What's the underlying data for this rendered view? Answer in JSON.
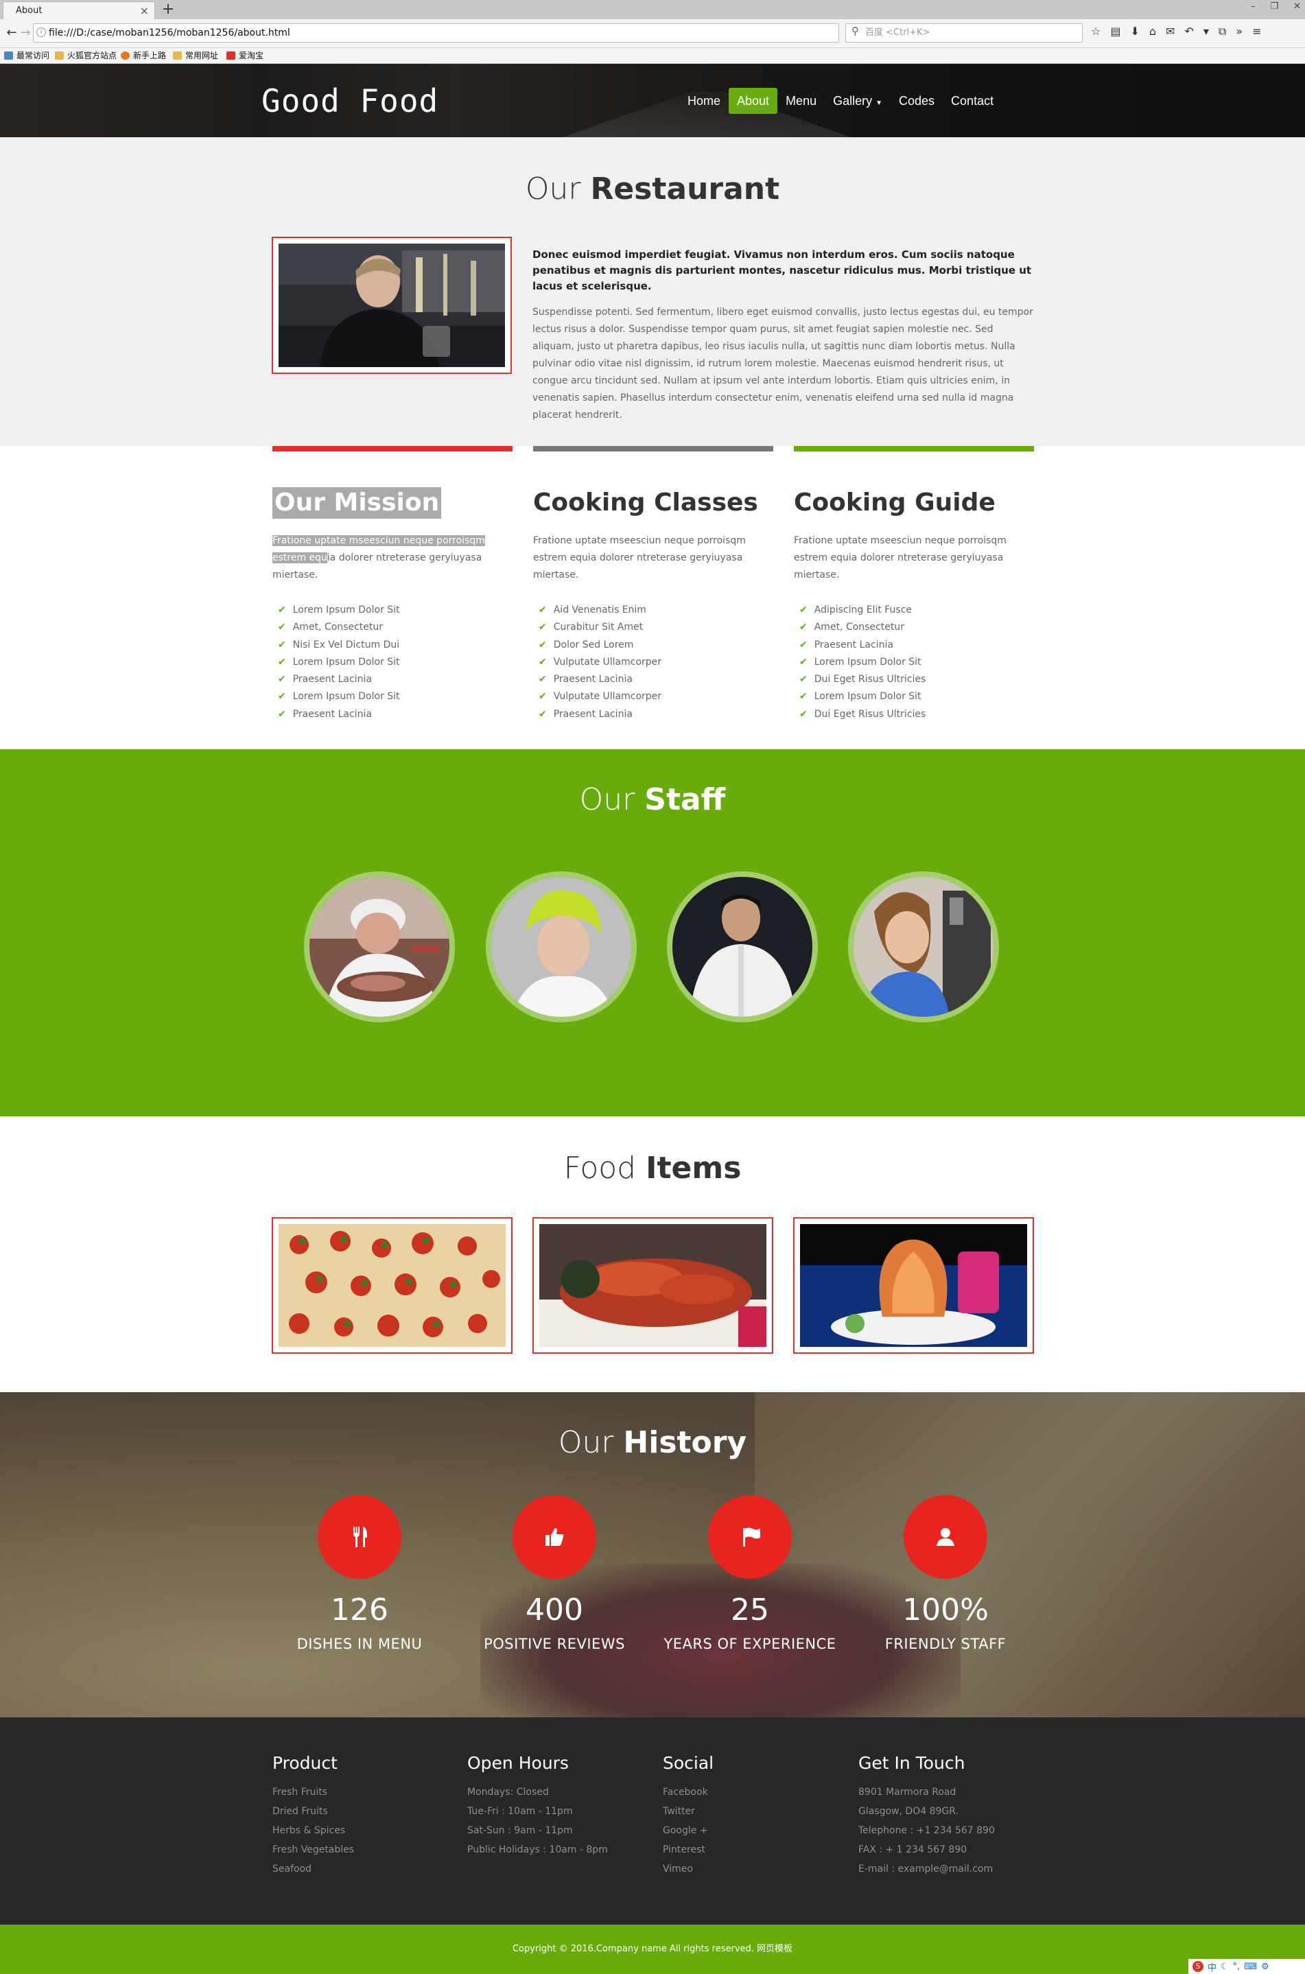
{
  "browser": {
    "tab_title": "About",
    "new_tab_label": "+",
    "url": "file:///D:/case/moban1256/moban1256/about.html",
    "search_placeholder": "百度 <Ctrl+K>",
    "bookmarks": [
      "最常访问",
      "火狐官方站点",
      "新手上路",
      "常用网址",
      "爱淘宝"
    ]
  },
  "site": {
    "logo": "Good Food",
    "nav": [
      {
        "label": "Home",
        "active": false
      },
      {
        "label": "About",
        "active": true
      },
      {
        "label": "Menu",
        "active": false
      },
      {
        "label": "Gallery",
        "active": false,
        "dropdown": true
      },
      {
        "label": "Codes",
        "active": false
      },
      {
        "label": "Contact",
        "active": false
      }
    ],
    "accent_green": "#68ac0b",
    "accent_red": "#e0302a"
  },
  "restaurant": {
    "title_light": "Our",
    "title_bold": "Restaurant",
    "lead": "Donec euismod imperdiet feugiat. Vivamus non interdum eros. Cum sociis natoque penatibus et magnis dis parturient montes, nascetur ridiculus mus. Morbi tristique ut lacus et scelerisque.",
    "body": "Suspendisse potenti. Sed fermentum, libero eget euismod convallis, justo lectus egestas dui, eu tempor lectus risus a dolor. Suspendisse tempor quam purus, sit amet feugiat sapien molestie nec. Sed aliquam, justo ut pharetra dapibus, leo risus iaculis nulla, ut sagittis nunc diam lobortis metus. Nulla pulvinar odio vitae nisl dignissim, id rutrum lorem molestie. Maecenas euismod hendrerit risus, ut congue arcu tincidunt sed. Nullam at ipsum vel ante interdum lobortis. Etiam quis ultricies enim, in venenatis sapien. Phasellus interdum consectetur enim, venenatis eleifend urna sed nulla id magna placerat hendrerit."
  },
  "features": [
    {
      "title": "Our Mission",
      "bar_color": "#e0302a",
      "text_selected": "Fratione uptate mseesciun neque porroisqm estrem equ",
      "text_rest": "ia dolorer ntreterase geryiuyasa miertase.",
      "items": [
        "Lorem Ipsum Dolor Sit",
        "Amet, Consectetur",
        "Nisi Ex Vel Dictum Dui",
        "Lorem Ipsum Dolor Sit",
        "Praesent Lacinia",
        "Lorem Ipsum Dolor Sit",
        "Praesent Lacinia"
      ]
    },
    {
      "title": "Cooking Classes",
      "bar_color": "#777777",
      "text_selected": "",
      "text_rest": "Fratione uptate mseesciun neque porroisqm estrem equia dolorer ntreterase geryiuyasa miertase.",
      "items": [
        "Aid Venenatis Enim",
        "Curabitur Sit Amet",
        "Dolor Sed Lorem",
        "Vulputate Ullamcorper",
        "Praesent Lacinia",
        "Vulputate Ullamcorper",
        "Praesent Lacinia"
      ]
    },
    {
      "title": "Cooking Guide",
      "bar_color": "#68ac0b",
      "text_selected": "",
      "text_rest": "Fratione uptate mseesciun neque porroisqm estrem equia dolorer ntreterase geryiuyasa miertase.",
      "items": [
        "Adipiscing Elit Fusce",
        "Amet, Consectetur",
        "Praesent Lacinia",
        "Lorem Ipsum Dolor Sit",
        "Dui Eget Risus Ultricies",
        "Lorem Ipsum Dolor Sit",
        "Dui Eget Risus Ultricies"
      ]
    }
  ],
  "staff": {
    "title_light": "Our",
    "title_bold": "Staff"
  },
  "food": {
    "title_light": "Food",
    "title_bold": "Items"
  },
  "history": {
    "title_light": "Our",
    "title_bold": "History",
    "stats": [
      {
        "icon": "cutlery-icon",
        "number": "126",
        "label": "DISHES IN MENU"
      },
      {
        "icon": "thumbs-up-icon",
        "number": "400",
        "label": "POSITIVE REVIEWS"
      },
      {
        "icon": "flag-icon",
        "number": "25",
        "label": "YEARS OF EXPERIENCE"
      },
      {
        "icon": "user-icon",
        "number": "100%",
        "label": "FRIENDLY STAFF"
      }
    ]
  },
  "footer": {
    "product": {
      "title": "Product",
      "items": [
        "Fresh Fruits",
        "Dried Fruits",
        "Herbs & Spices",
        "Fresh Vegetables",
        "Seafood"
      ]
    },
    "hours": {
      "title": "Open Hours",
      "items": [
        "Mondays: Closed",
        "Tue-Fri : 10am - 11pm",
        "Sat-Sun : 9am - 11pm",
        "Public Holidays : 10am - 8pm"
      ]
    },
    "social": {
      "title": "Social",
      "items": [
        "Facebook",
        "Twitter",
        "Google +",
        "Pinterest",
        "Vimeo"
      ]
    },
    "contact": {
      "title": "Get In Touch",
      "items": [
        "8901 Marmora Road",
        "Glasgow, DO4 89GR.",
        "Telephone : +1 234 567 890",
        "FAX : + 1 234 567 890",
        "E-mail : example@mail.com"
      ]
    },
    "copyright": "Copyright © 2016.Company name All rights reserved. 网页模板"
  },
  "tray": {
    "ime_label": "中"
  }
}
